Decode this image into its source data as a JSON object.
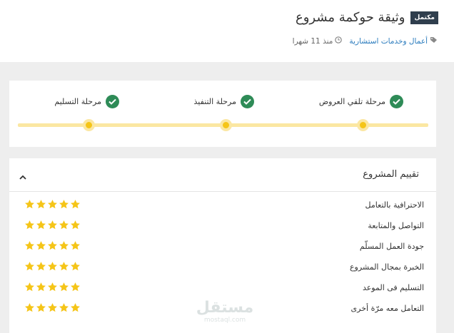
{
  "header": {
    "badge": "مكتمل",
    "title": "وثيقة حوكمة مشروع",
    "category": "أعمال وخدمات استشارية",
    "time": "منذ 11 شهرا"
  },
  "stages": [
    {
      "label": "مرحلة تلقي العروض",
      "status": "done"
    },
    {
      "label": "مرحلة التنفيذ",
      "status": "done"
    },
    {
      "label": "مرحلة التسليم",
      "status": "done"
    }
  ],
  "rating": {
    "title": "تقييم المشروع",
    "items": [
      {
        "label": "الاحترافية بالتعامل",
        "stars": 5
      },
      {
        "label": "التواصل والمتابعة",
        "stars": 5
      },
      {
        "label": "جودة العمل المسلّم",
        "stars": 5
      },
      {
        "label": "الخبرة بمجال المشروع",
        "stars": 5
      },
      {
        "label": "التسليم فى الموعد",
        "stars": 5
      },
      {
        "label": "التعامل معه مرّة أخرى",
        "stars": 5
      }
    ]
  },
  "watermark": {
    "brand": "مستقل",
    "domain": "mostaql.com"
  },
  "colors": {
    "check": "#2e8b57",
    "star": "#f5c518",
    "track": "#fbe7a2",
    "badge": "#2f3e4d",
    "link": "#2a7bbd"
  }
}
